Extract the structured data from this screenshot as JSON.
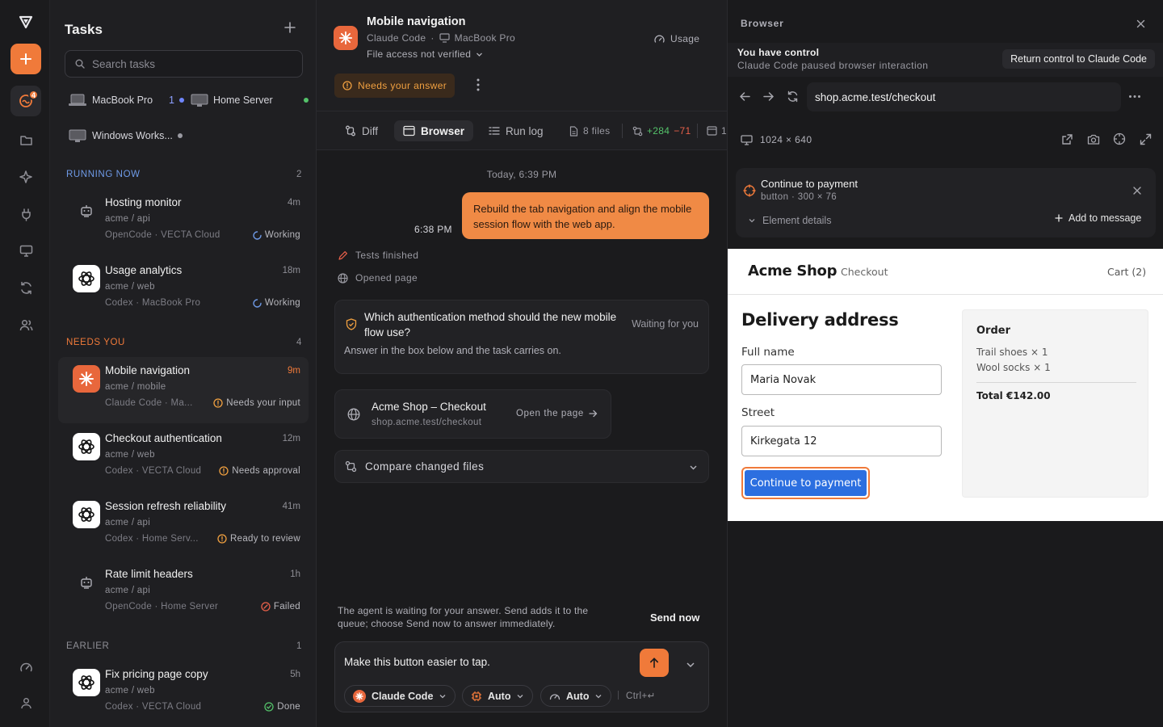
{
  "rail": {
    "badge_count": "4"
  },
  "sidebar": {
    "title": "Tasks",
    "search_placeholder": "Search tasks",
    "devices": [
      {
        "name": "MacBook Pro",
        "count": "1"
      },
      {
        "name": "Home Server"
      },
      {
        "name": "Windows Works..."
      }
    ],
    "sections": {
      "running": {
        "label": "RUNNING NOW",
        "count": "2"
      },
      "needs": {
        "label": "NEEDS YOU",
        "count": "4"
      },
      "earlier": {
        "label": "EARLIER",
        "count": "1"
      }
    },
    "tasks": [
      {
        "name": "Hosting monitor",
        "time": "4m",
        "repo": "acme / api",
        "meta": "OpenCode · VECTA Cloud",
        "status": "Working"
      },
      {
        "name": "Usage analytics",
        "time": "18m",
        "repo": "acme / web",
        "meta": "Codex · MacBook Pro",
        "status": "Working"
      },
      {
        "name": "Mobile navigation",
        "time": "9m",
        "repo": "acme / mobile",
        "meta": "Claude Code · Ma...",
        "status": "Needs your input"
      },
      {
        "name": "Checkout authentication",
        "time": "12m",
        "repo": "acme / web",
        "meta": "Codex · VECTA Cloud",
        "status": "Needs approval"
      },
      {
        "name": "Session refresh reliability",
        "time": "41m",
        "repo": "acme / api",
        "meta": "Codex · Home Serv...",
        "status": "Ready to review"
      },
      {
        "name": "Rate limit headers",
        "time": "1h",
        "repo": "acme / api",
        "meta": "OpenCode · Home Server",
        "status": "Failed"
      },
      {
        "name": "Fix pricing page copy",
        "time": "5h",
        "repo": "acme / web",
        "meta": "Codex · VECTA Cloud",
        "status": "Done"
      }
    ]
  },
  "main": {
    "title": "Mobile navigation",
    "agent": "Claude Code",
    "sep": "·",
    "device": "MacBook Pro",
    "file_access": "File access not verified",
    "usage": "Usage",
    "needs_answer": "Needs your answer",
    "tabs": {
      "diff": "Diff",
      "browser": "Browser",
      "runlog": "Run log",
      "files": "8 files",
      "added": "+284",
      "removed": "−71",
      "more": "1"
    },
    "date_divider": "Today, 6:39 PM",
    "message_time": "6:38 PM",
    "message": "Rebuild the tab navigation and align the mobile session flow with the web app.",
    "events": [
      "Tests finished",
      "Opened page"
    ],
    "question": {
      "title": "Which authentication method should the new mobile flow use?",
      "status": "Waiting for you",
      "hint": "Answer in the box below and the task carries on."
    },
    "page_card": {
      "title": "Acme Shop – Checkout",
      "url": "shop.acme.test/checkout",
      "action": "Open the page"
    },
    "compare": "Compare changed files",
    "queue_note": "The agent is waiting for your answer. Send adds it to the queue; choose Send now to answer immediately.",
    "send_now": "Send now",
    "composer_text": "Make this button easier to tap.",
    "pills": {
      "agent": "Claude Code",
      "model": "Auto",
      "speed": "Auto"
    },
    "shortcut": "Ctrl+↵"
  },
  "browser": {
    "title": "Browser",
    "control_title": "You have control",
    "control_sub": "Claude Code paused browser interaction",
    "return_btn": "Return control to Claude Code",
    "url": "shop.acme.test/checkout",
    "viewport": "1024 × 640",
    "element": {
      "name": "Continue to payment",
      "meta": "button · 300 × 76",
      "details": "Element details",
      "add": "Add to message"
    },
    "page": {
      "brand": "Acme Shop",
      "crumb": "Checkout",
      "cart": "Cart (2)",
      "heading": "Delivery address",
      "full_name_label": "Full name",
      "full_name_value": "Maria Novak",
      "street_label": "Street",
      "street_value": "Kirkegata 12",
      "button": "Continue to payment",
      "order_title": "Order",
      "items": [
        "Trail shoes × 1",
        "Wool socks × 1"
      ],
      "total": "Total €142.00"
    }
  }
}
